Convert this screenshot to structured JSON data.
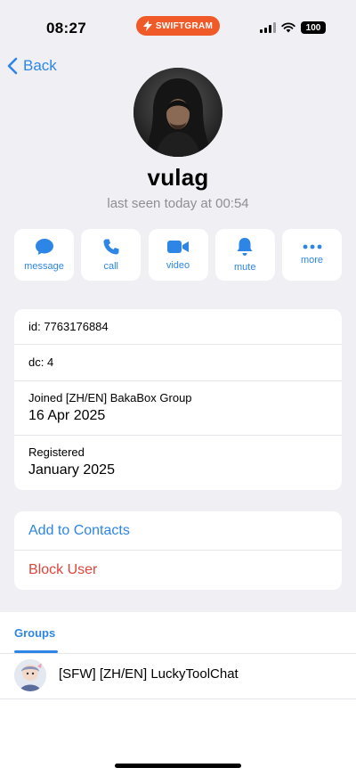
{
  "status_bar": {
    "time": "08:27",
    "brand": "SWIFTGRAM",
    "battery": "100"
  },
  "nav": {
    "back_label": "Back"
  },
  "profile": {
    "name": "vulag",
    "last_seen": "last seen today at 00:54"
  },
  "actions": [
    {
      "label": "message",
      "icon": "message-bubble-icon"
    },
    {
      "label": "call",
      "icon": "phone-icon"
    },
    {
      "label": "video",
      "icon": "video-camera-icon"
    },
    {
      "label": "mute",
      "icon": "bell-icon"
    },
    {
      "label": "more",
      "icon": "ellipsis-icon"
    }
  ],
  "info": {
    "id": "id: 7763176884",
    "dc": "dc: 4",
    "joined_label": "Joined [ZH/EN] BakaBox Group",
    "joined_date": "16 Apr 2025",
    "registered_label": "Registered",
    "registered_date": "January 2025"
  },
  "contact_actions": {
    "add": "Add to Contacts",
    "block": "Block User"
  },
  "tabs": {
    "groups_label": "Groups"
  },
  "groups": [
    {
      "name": "[SFW] [ZH/EN] LuckyToolChat"
    }
  ],
  "colors": {
    "accent": "#2d86e6",
    "danger": "#e0443a",
    "brand": "#f05a28",
    "background": "#efeff4"
  }
}
